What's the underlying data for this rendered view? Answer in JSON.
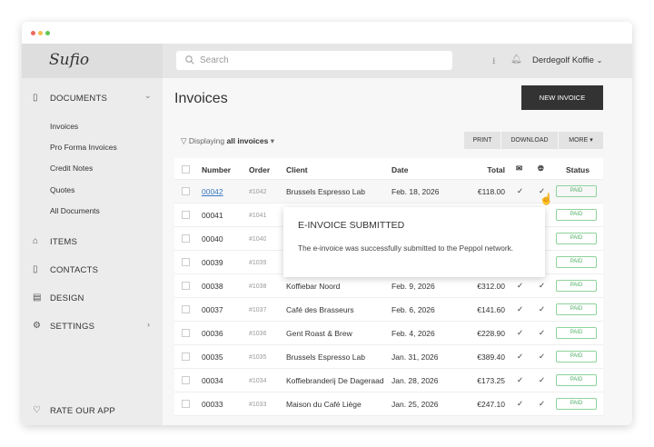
{
  "window": {
    "colors": {
      "close": "#ec6a5e",
      "min": "#f4bf4f",
      "max": "#61c554"
    }
  },
  "header": {
    "logo": "Sufio",
    "search_placeholder": "Search",
    "user": "Derdegolf Koffie"
  },
  "sidebar": {
    "documents": "DOCUMENTS",
    "sub": [
      "Invoices",
      "Pro Forma Invoices",
      "Credit Notes",
      "Quotes",
      "All Documents"
    ],
    "items": "ITEMS",
    "contacts": "CONTACTS",
    "design": "DESIGN",
    "settings": "SETTINGS",
    "rate": "RATE OUR APP"
  },
  "main": {
    "title": "Invoices",
    "new_invoice": "NEW INVOICE",
    "filter_prefix": "Displaying",
    "filter_value": "all invoices",
    "print": "PRINT",
    "download": "DOWNLOAD",
    "more": "MORE",
    "columns": {
      "number": "Number",
      "order": "Order",
      "client": "Client",
      "date": "Date",
      "total": "Total",
      "status": "Status"
    },
    "rows": [
      {
        "number": "00042",
        "order": "#1042",
        "client": "Brussels Espresso Lab",
        "date": "Feb. 18, 2026",
        "total": "€118.00",
        "status": "PAID"
      },
      {
        "number": "00041",
        "order": "#1041",
        "client": "",
        "date": "",
        "total": "",
        "status": "PAID"
      },
      {
        "number": "00040",
        "order": "#1040",
        "client": "",
        "date": "",
        "total": "",
        "status": "PAID"
      },
      {
        "number": "00039",
        "order": "#1039",
        "client": "",
        "date": "",
        "total": "",
        "status": "PAID"
      },
      {
        "number": "00038",
        "order": "#1038",
        "client": "Koffiebar Noord",
        "date": "Feb. 9, 2026",
        "total": "€312.00",
        "status": "PAID"
      },
      {
        "number": "00037",
        "order": "#1037",
        "client": "Café des Brasseurs",
        "date": "Feb. 6, 2026",
        "total": "€141.60",
        "status": "PAID"
      },
      {
        "number": "00036",
        "order": "#1036",
        "client": "Gent Roast & Brew",
        "date": "Feb. 4, 2026",
        "total": "€228.90",
        "status": "PAID"
      },
      {
        "number": "00035",
        "order": "#1035",
        "client": "Brussels Espresso Lab",
        "date": "Jan. 31, 2026",
        "total": "€389.40",
        "status": "PAID"
      },
      {
        "number": "00034",
        "order": "#1034",
        "client": "Koffiebranderij De Dageraad",
        "date": "Jan. 28, 2026",
        "total": "€173.25",
        "status": "PAID"
      },
      {
        "number": "00033",
        "order": "#1033",
        "client": "Maison du Café Liège",
        "date": "Jan. 25, 2026",
        "total": "€247.10",
        "status": "PAID"
      }
    ]
  },
  "tooltip": {
    "title": "E-INVOICE SUBMITTED",
    "body": "The e-invoice was successfully submitted to the Peppol network."
  }
}
